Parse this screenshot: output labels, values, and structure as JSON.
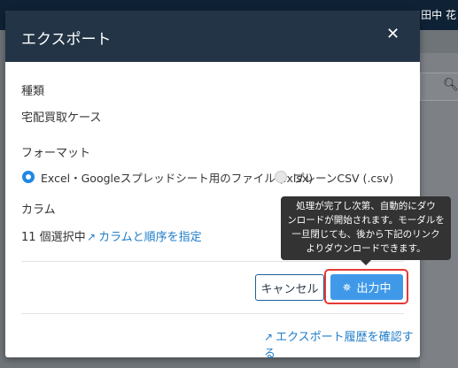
{
  "background": {
    "user_name": "田中 花"
  },
  "modal": {
    "title": "エクスポート",
    "type_label": "種類",
    "type_value": "宅配買取ケース",
    "format_label": "フォーマット",
    "format_options": [
      {
        "label": "Excel・Googleスプレッドシート用のファイル (.xlsx)",
        "selected": true
      },
      {
        "label": "プレーンCSV (.csv)",
        "selected": false
      }
    ],
    "column_label": "カラム",
    "column_count_text": "11 個選択中",
    "column_link": "カラムと順序を指定",
    "cancel_label": "キャンセル",
    "output_label": "出力中",
    "history_link": "エクスポート履歴を確認する",
    "tooltip_lines": [
      "処理が完了し次第、自動的にダウ",
      "ンロードが開始されます。モーダルを",
      "一旦閉じても、後から下記のリンク",
      "よりダウンロードできます。"
    ]
  },
  "colors": {
    "header_bg": "#233446",
    "primary": "#1e88e5",
    "link": "#1e7cc8",
    "highlight": "#e53935"
  },
  "icons": [
    "close-icon",
    "external-link-icon",
    "spinner-icon",
    "search-icon"
  ]
}
